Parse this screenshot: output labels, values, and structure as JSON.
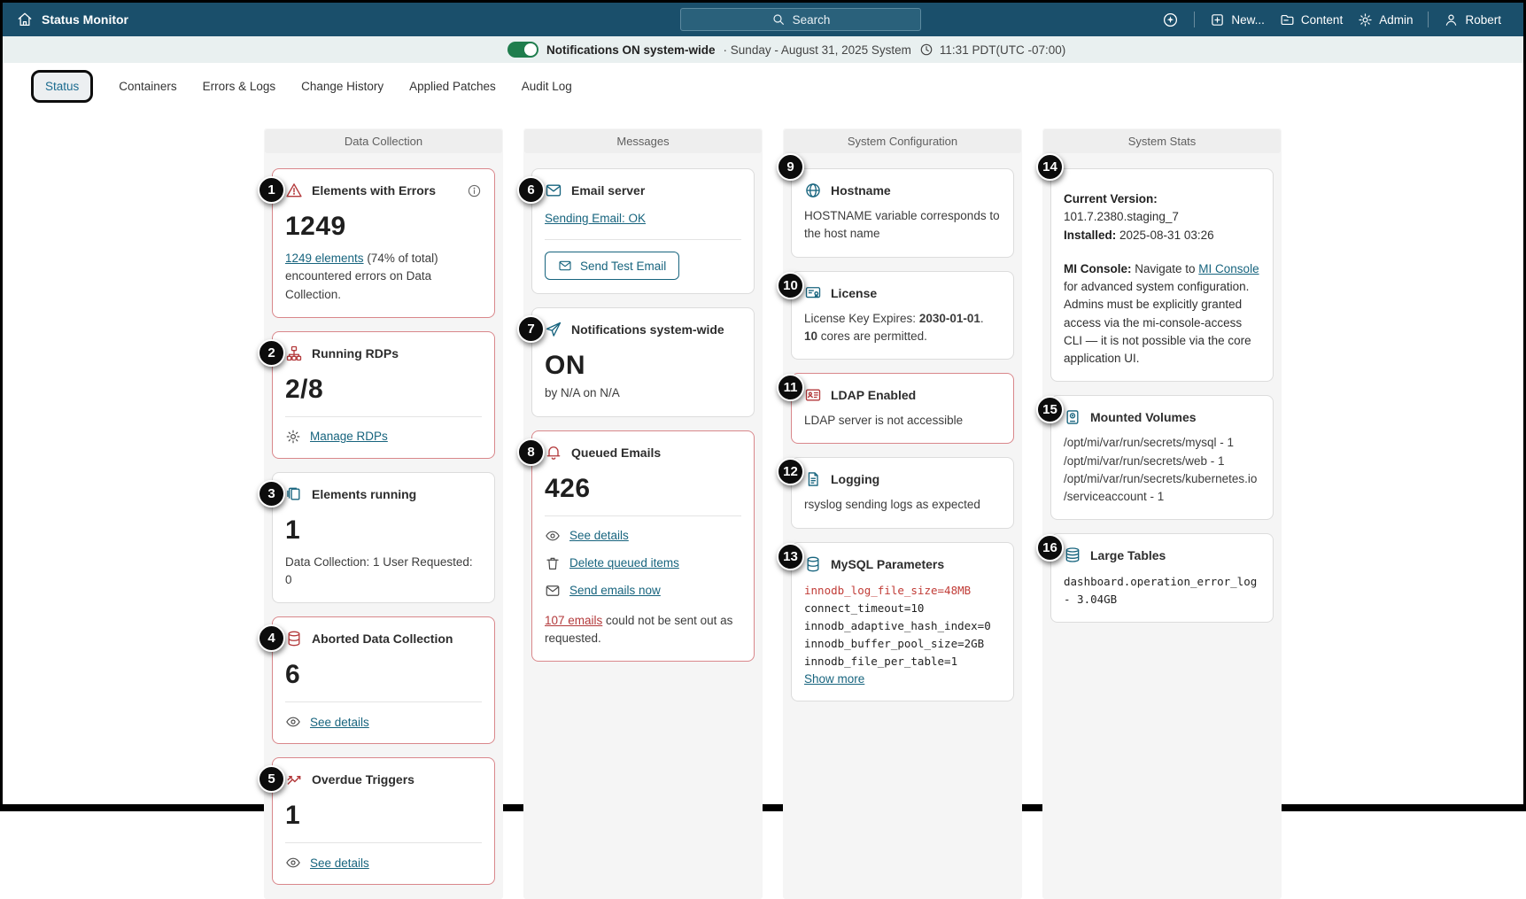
{
  "header": {
    "title": "Status Monitor",
    "search_label": "Search",
    "nav_new": "New...",
    "nav_content": "Content",
    "nav_admin": "Admin",
    "nav_user": "Robert"
  },
  "notification": {
    "state": "on",
    "message": "Notifications ON system-wide",
    "date": "· Sunday - August 31, 2025 System",
    "time": "11:31 PDT(UTC -07:00)"
  },
  "tabs": [
    {
      "label": "Status",
      "active": true
    },
    {
      "label": "Containers",
      "active": false
    },
    {
      "label": "Errors & Logs",
      "active": false
    },
    {
      "label": "Change History",
      "active": false
    },
    {
      "label": "Applied Patches",
      "active": false
    },
    {
      "label": "Audit Log",
      "active": false
    }
  ],
  "columns": [
    {
      "title": "Data Collection",
      "cards": [
        {
          "badge": "1",
          "title": "Elements with Errors",
          "big": "1249",
          "link_text": "1249 elements",
          "desc_after_link": " (74% of total) encountered errors on Data Collection."
        },
        {
          "badge": "2",
          "title": "Running RDPs",
          "big": "2/8",
          "action": "Manage RDPs"
        },
        {
          "badge": "3",
          "title": "Elements running",
          "big": "1",
          "desc": "Data Collection: 1 User Requested: 0"
        },
        {
          "badge": "4",
          "title": "Aborted Data Collection",
          "big": "6",
          "action": "See details"
        },
        {
          "badge": "5",
          "title": "Overdue Triggers",
          "big": "1",
          "action": "See details"
        }
      ]
    },
    {
      "title": "Messages",
      "cards": [
        {
          "badge": "6",
          "title": "Email server",
          "status_link": "Sending Email: OK",
          "button": "Send Test Email"
        },
        {
          "badge": "7",
          "title": "Notifications system-wide",
          "big": "ON",
          "desc": "by N/A on N/A"
        },
        {
          "badge": "8",
          "title": "Queued Emails",
          "big": "426",
          "actions": [
            "See details",
            "Delete queued items",
            "Send emails now"
          ],
          "error_link": "107 emails",
          "error_text": " could not be sent out as requested."
        }
      ]
    },
    {
      "title": "System Configuration",
      "cards": [
        {
          "badge": "9",
          "title": "Hostname",
          "desc": "HOSTNAME variable corresponds to the host name"
        },
        {
          "badge": "10",
          "title": "License",
          "lic_pre": "License Key Expires: ",
          "lic_date": "2030-01-01",
          "lic_mid": ".",
          "lic_cores": "10",
          "lic_post": " cores are permitted."
        },
        {
          "badge": "11",
          "title": "LDAP Enabled",
          "desc": "LDAP server is not accessible"
        },
        {
          "badge": "12",
          "title": "Logging",
          "desc": "rsyslog sending logs as expected"
        },
        {
          "badge": "13",
          "title": "MySQL Parameters",
          "code_alert": "innodb_log_file_size=48MB",
          "code_lines": [
            "connect_timeout=10",
            "innodb_adaptive_hash_index=0",
            "innodb_buffer_pool_size=2GB",
            "innodb_file_per_table=1"
          ],
          "more": "Show more"
        }
      ]
    },
    {
      "title": "System Stats",
      "cards": [
        {
          "badge": "14",
          "version_label": "Current Version:",
          "version_value": " 101.7.2380.staging_7",
          "installed_label": "Installed:",
          "installed_value": " 2025-08-31 03:26",
          "mi_label": "MI Console:",
          "mi_pre": " Navigate to ",
          "mi_link": "MI Console",
          "mi_post": " for advanced system configuration. Admins must be explicitly granted access via the mi-console-access CLI — it is not possible via the core application UI."
        },
        {
          "badge": "15",
          "title": "Mounted Volumes",
          "lines": [
            "/opt/mi/var/run/secrets/mysql - 1",
            "/opt/mi/var/run/secrets/web - 1",
            "/opt/mi/var/run/secrets/kubernetes.io/serviceaccount - 1"
          ]
        },
        {
          "badge": "16",
          "title": "Large Tables",
          "code_lines": [
            "dashboard.operation_error_log - 3.04GB"
          ]
        }
      ]
    }
  ],
  "colors": {
    "header_bg": "#1a4f6b",
    "accent_link": "#17647e",
    "alert_red": "#b3393b",
    "code_alert_red": "#c13c37",
    "toggle_green": "#1f7d4d",
    "badge_black": "#0c0c0c",
    "notif_bar_bg": "#e9f0f0",
    "column_bg": "#f5f5f5"
  }
}
